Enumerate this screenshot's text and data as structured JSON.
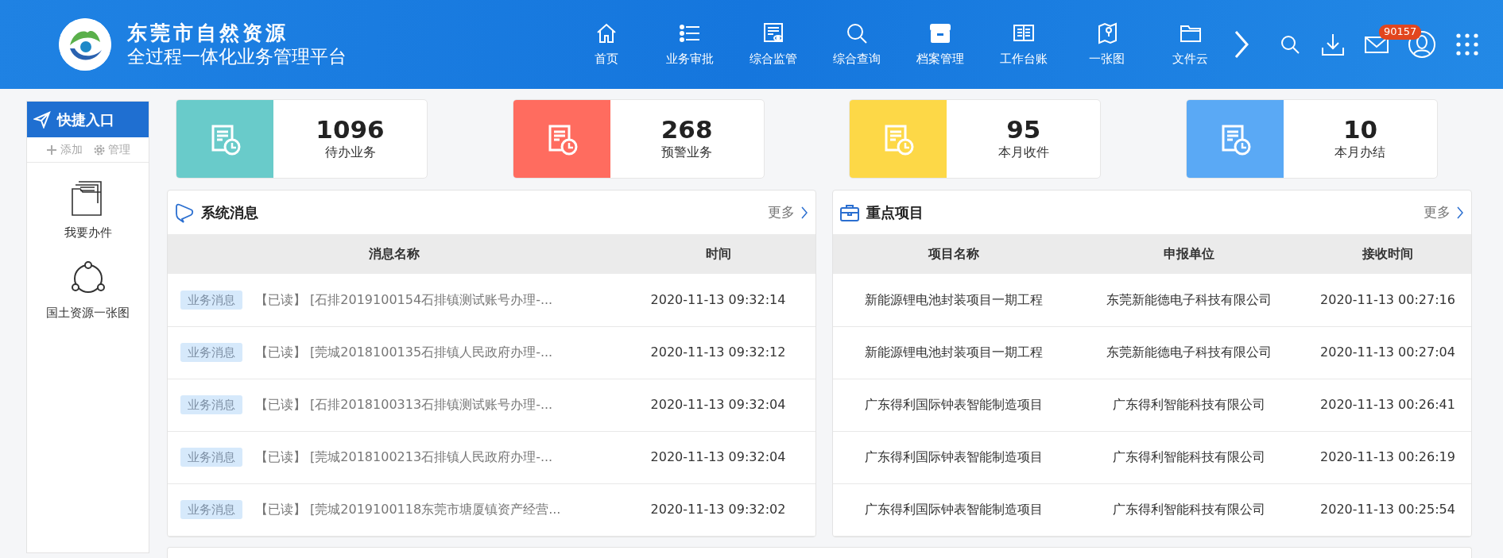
{
  "header": {
    "title": "东莞市自然资源",
    "subtitle": "全过程一体化业务管理平台",
    "nav": [
      {
        "label": "首页",
        "kind": "home"
      },
      {
        "label": "业务审批",
        "kind": "list"
      },
      {
        "label": "综合监管",
        "kind": "monitor"
      },
      {
        "label": "综合查询",
        "kind": "search"
      },
      {
        "label": "档案管理",
        "kind": "archive"
      },
      {
        "label": "工作台账",
        "kind": "ledger"
      },
      {
        "label": "一张图",
        "kind": "map"
      },
      {
        "label": "文件云",
        "kind": "folder"
      }
    ],
    "mail_badge": "90157"
  },
  "sidebar": {
    "title": "快捷入口",
    "actions": [
      {
        "label": "添加",
        "kind": "add"
      },
      {
        "label": "管理",
        "kind": "gear"
      }
    ],
    "items": [
      {
        "label": "我要办件",
        "kind": "folder"
      },
      {
        "label": "国土资源一张图",
        "kind": "share"
      }
    ]
  },
  "stats": [
    {
      "value": "1096",
      "label": "待办业务",
      "color": "#69cbca"
    },
    {
      "value": "268",
      "label": "预警业务",
      "color": "#ff6c5f"
    },
    {
      "value": "95",
      "label": "本月收件",
      "color": "#fdd847"
    },
    {
      "value": "10",
      "label": "本月办结",
      "color": "#5aa9f5"
    }
  ],
  "messages": {
    "title": "系统消息",
    "more": "更多",
    "columns": [
      "消息名称",
      "时间"
    ],
    "rows": [
      {
        "tag": "业务消息",
        "text": "【已读】 [石排2019100154石排镇测试账号办理-...",
        "time": "2020-11-13 09:32:14"
      },
      {
        "tag": "业务消息",
        "text": "【已读】 [莞城2018100135石排镇人民政府办理-...",
        "time": "2020-11-13 09:32:12"
      },
      {
        "tag": "业务消息",
        "text": "【已读】 [石排2018100313石排镇测试账号办理-...",
        "time": "2020-11-13 09:32:04"
      },
      {
        "tag": "业务消息",
        "text": "【已读】 [莞城2018100213石排镇人民政府办理-...",
        "time": "2020-11-13 09:32:04"
      },
      {
        "tag": "业务消息",
        "text": "【已读】 [莞城2019100118东莞市塘厦镇资产经营...",
        "time": "2020-11-13 09:32:02"
      }
    ]
  },
  "projects": {
    "title": "重点项目",
    "more": "更多",
    "columns": [
      "项目名称",
      "申报单位",
      "接收时间"
    ],
    "rows": [
      {
        "name": "新能源锂电池封装项目一期工程",
        "unit": "东莞新能德电子科技有限公司",
        "time": "2020-11-13 00:27:16"
      },
      {
        "name": "新能源锂电池封装项目一期工程",
        "unit": "东莞新能德电子科技有限公司",
        "time": "2020-11-13 00:27:04"
      },
      {
        "name": "广东得利国际钟表智能制造项目",
        "unit": "广东得利智能科技有限公司",
        "time": "2020-11-13 00:26:41"
      },
      {
        "name": "广东得利国际钟表智能制造项目",
        "unit": "广东得利智能科技有限公司",
        "time": "2020-11-13 00:26:19"
      },
      {
        "name": "广东得利国际钟表智能制造项目",
        "unit": "广东得利智能科技有限公司",
        "time": "2020-11-13 00:25:54"
      }
    ]
  }
}
